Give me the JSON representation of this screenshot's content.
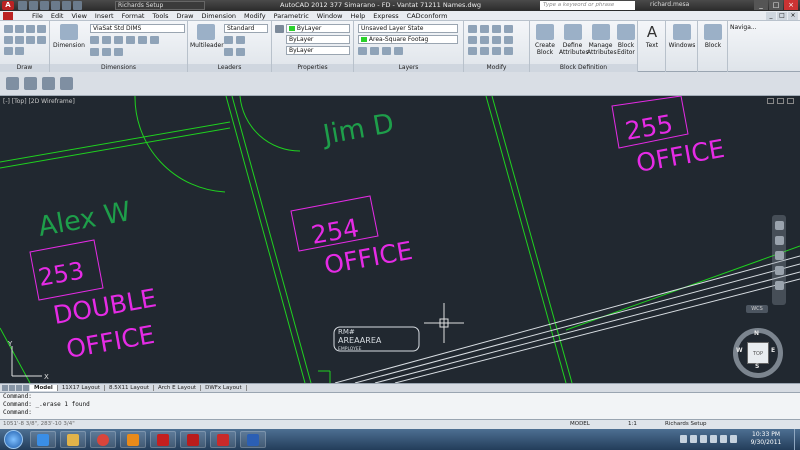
{
  "titlebar": {
    "app_letter": "A",
    "workspace": "Richards Setup",
    "title": "AutoCAD 2012   377 Simarano - FD - Vantat 71211 Names.dwg",
    "search_placeholder": "Type a keyword or phrase",
    "user": "richard.mesa"
  },
  "menu": [
    "File",
    "Edit",
    "View",
    "Insert",
    "Format",
    "Tools",
    "Draw",
    "Dimension",
    "Modify",
    "Parametric",
    "Window",
    "Help",
    "Express",
    "CADconform"
  ],
  "ribbon": {
    "panels": {
      "draw": "Draw",
      "dimensions": "Dimensions",
      "leaders": "Leaders",
      "properties": "Properties",
      "layers": "Layers",
      "modify": "Modify",
      "block_definition": "Block Definition"
    },
    "dimension_label": "Dimension",
    "multileader_label": "Multileader",
    "dimstyle": "ViaSat Std DIMS",
    "leader_style": "Standard",
    "color": "ByLayer",
    "linetype": "ByLayer",
    "lineweight": "ByLayer",
    "layer_state": "Unsaved Layer State",
    "current_layer": "Area-Square Footag",
    "create_block": "Create Block",
    "define_attributes": "Define Attributes",
    "manage_attributes": "Manage Attributes",
    "block_editor": "Block Editor",
    "text": "Text",
    "windows": "Windows",
    "block": "Block",
    "navigate": "Naviga..."
  },
  "viewport": {
    "label": "[-] [Top] [2D Wireframe]",
    "wcs": "WCS",
    "viewcube_face": "TOP",
    "compass": {
      "n": "N",
      "s": "S",
      "e": "E",
      "w": "W"
    },
    "rooms": [
      {
        "number": "253",
        "lines": [
          "DOUBLE",
          "OFFICE"
        ],
        "occupant": "Alex W"
      },
      {
        "number": "254",
        "lines": [
          "OFFICE"
        ],
        "occupant": ""
      },
      {
        "number": "255",
        "lines": [
          "OFFICE"
        ],
        "occupant": ""
      }
    ],
    "occupant_jim": "Jim D",
    "tag": {
      "line1": "RM#",
      "line2": "AREAAREA",
      "line3": "EMPLOYEE"
    },
    "colors": {
      "background": "#212830",
      "room_text": "#e52be5",
      "occupant_text": "#1e9e4a",
      "walls": "#1fd11f",
      "white_lines": "#d8dde2"
    }
  },
  "tabs": [
    "Model",
    "11X17 Layout",
    "8.5X11 Layout",
    "Arch E Layout",
    "DWFx Layout"
  ],
  "command": {
    "line1": "Command:",
    "line2": "Command: _.erase 1 found",
    "line3": "Command:"
  },
  "status": {
    "coords": "1051'-8 3/8\", 283'-10 3/4\"",
    "model": "MODEL",
    "scale": "1:1",
    "workspace": "Richards Setup"
  },
  "taskbar": {
    "time": "10:33 PM",
    "date": "9/30/2011"
  }
}
